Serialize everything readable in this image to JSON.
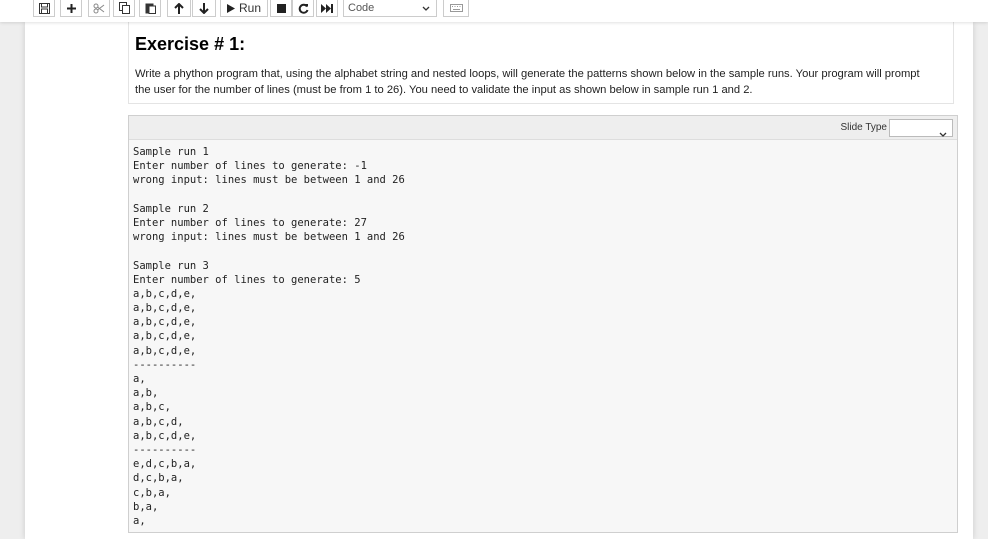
{
  "toolbar": {
    "run_label": "Run",
    "cell_type_value": "Code",
    "icons": [
      "save-icon",
      "plus-icon",
      "cut-icon",
      "copy-icon",
      "paste-icon",
      "arrow-up-icon",
      "arrow-down-icon",
      "play-icon",
      "stop-icon",
      "restart-icon",
      "fast-forward-icon",
      "keyboard-icon"
    ]
  },
  "markdown_cell": {
    "title": "Exercise # 1:",
    "text": "Write a phython program that, using the alphabet string and nested loops, will generate the patterns shown below in the sample runs. Your program will prompt the user for the number of lines (must be from 1 to 26). You need to validate the input as shown below in sample run 1 and 2."
  },
  "raw_cell": {
    "slide_type_label": "Slide Type",
    "slide_type_value": "",
    "lines": [
      "Sample run 1",
      "Enter number of lines to generate: -1",
      "wrong input: lines must be between 1 and 26",
      "",
      "Sample run 2",
      "Enter number of lines to generate: 27",
      "wrong input: lines must be between 1 and 26",
      "",
      "Sample run 3",
      "Enter number of lines to generate: 5",
      "a,b,c,d,e,",
      "a,b,c,d,e,",
      "a,b,c,d,e,",
      "a,b,c,d,e,",
      "a,b,c,d,e,",
      "----------",
      "a,",
      "a,b,",
      "a,b,c,",
      "a,b,c,d,",
      "a,b,c,d,e,",
      "----------",
      "e,d,c,b,a,",
      "d,c,b,a,",
      "c,b,a,",
      "b,a,",
      "a,"
    ]
  }
}
